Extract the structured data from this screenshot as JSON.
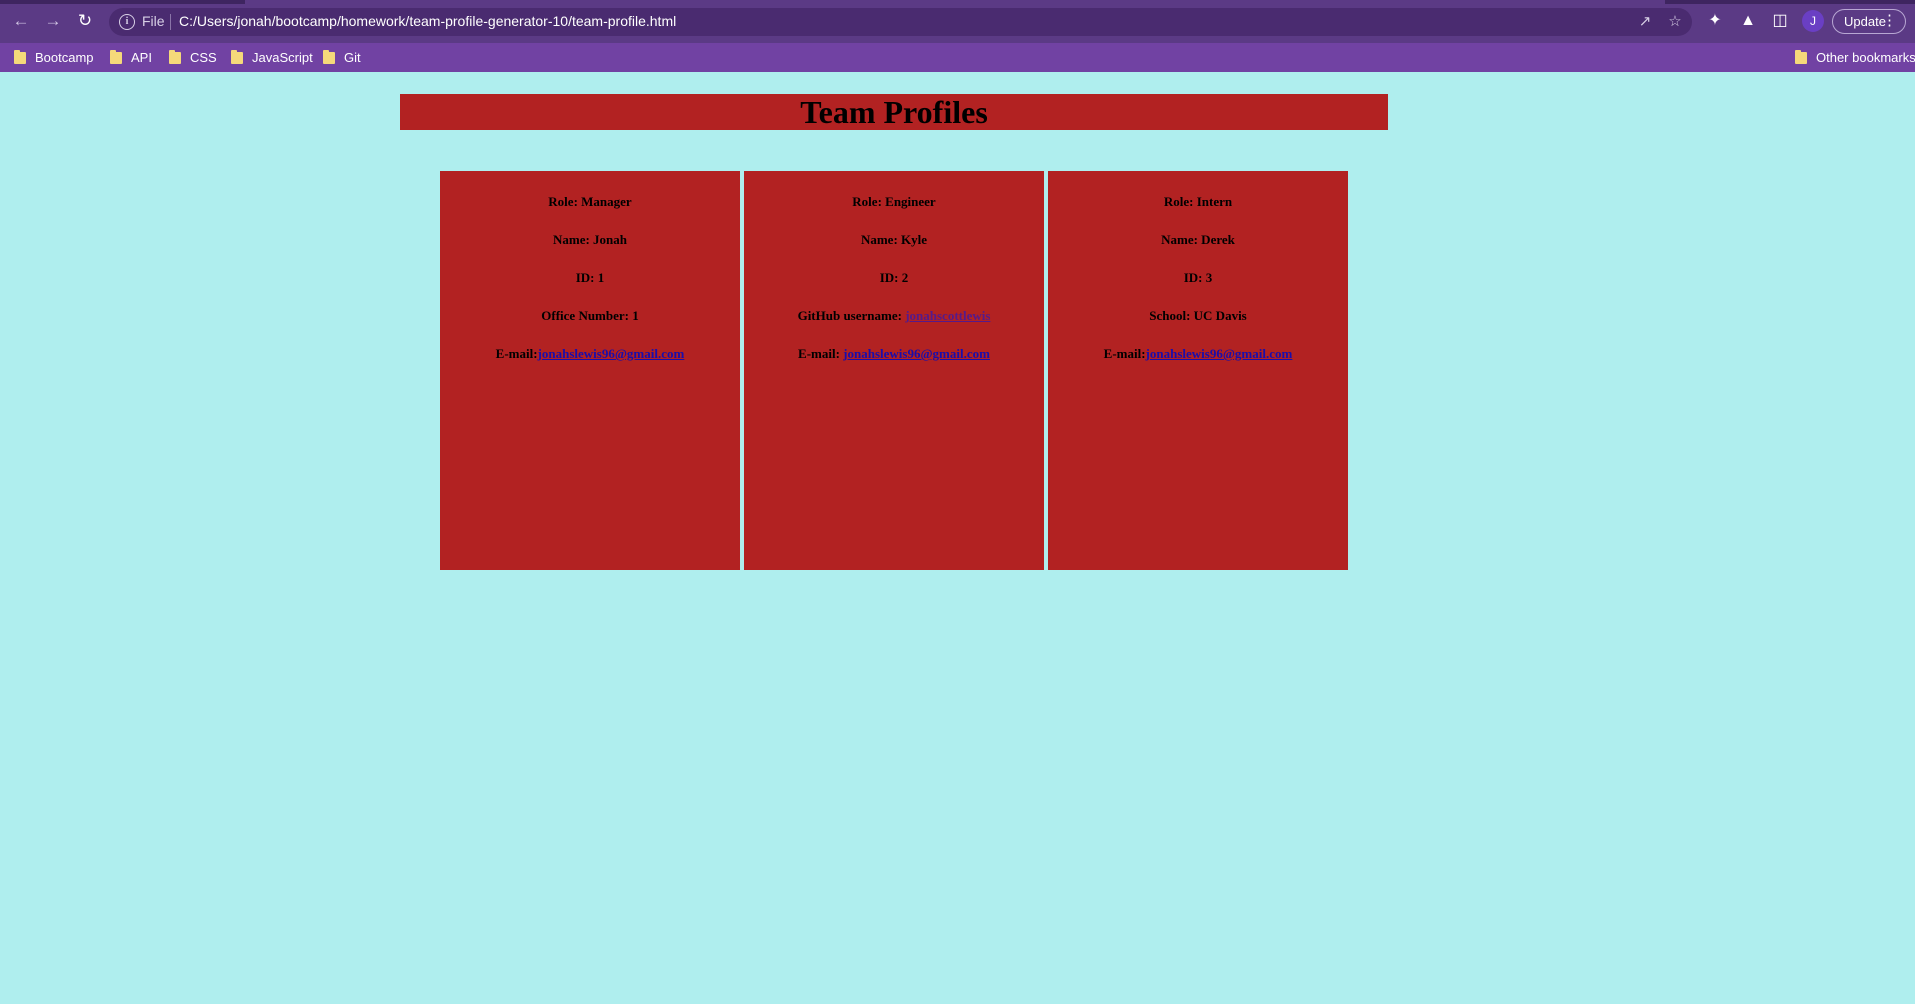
{
  "browser": {
    "file_label": "File",
    "url": "C:/Users/jonah/bootcamp/homework/team-profile-generator-10/team-profile.html",
    "profile_initial": "J",
    "update_label": "Update",
    "icons": {
      "back": "arrow-left-icon",
      "forward": "arrow-right-icon",
      "reload": "reload-icon",
      "info": "info-icon",
      "share": "share-icon",
      "star": "star-icon",
      "extensions": "puzzle-icon",
      "labs": "flask-icon",
      "side_panel": "side-panel-icon",
      "menu": "kebab-menu-icon"
    }
  },
  "bookmarks": {
    "items": [
      {
        "label": "Bootcamp"
      },
      {
        "label": "API"
      },
      {
        "label": "CSS"
      },
      {
        "label": "JavaScript"
      },
      {
        "label": "Git"
      }
    ],
    "other_label": "Other bookmarks"
  },
  "page": {
    "title": "Team Profiles",
    "colors": {
      "background": "#afeeee",
      "card": "#b22222",
      "link": "#1a0dab",
      "visited_link": "#551a8b"
    },
    "cards": [
      {
        "role": "Role: Manager",
        "name": "Name: Jonah",
        "id": "ID: 1",
        "extra_label": "Office Number: 1",
        "extra_link": "",
        "email_label": "E-mail:",
        "email": "jonahslewis96@gmail.com"
      },
      {
        "role": "Role: Engineer",
        "name": "Name: Kyle",
        "id": "ID: 2",
        "extra_label": "GitHub username: ",
        "extra_link": "jonahscottlewis",
        "email_label": "E-mail: ",
        "email": "jonahslewis96@gmail.com"
      },
      {
        "role": "Role: Intern",
        "name": "Name: Derek",
        "id": "ID: 3",
        "extra_label": "School: UC Davis",
        "extra_link": "",
        "email_label": "E-mail:",
        "email": "jonahslewis96@gmail.com"
      }
    ]
  }
}
